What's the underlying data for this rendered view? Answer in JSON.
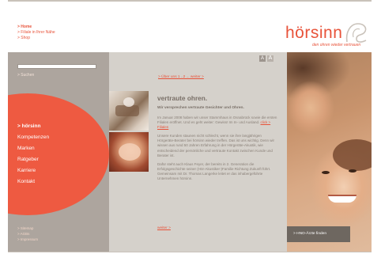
{
  "topnav": {
    "items": [
      "> Home",
      "> Filiale in Ihrer Nähe",
      "> Shop"
    ]
  },
  "logo": {
    "wordmark": "hörsinn",
    "tagline": "den ohren wieder vertrauen"
  },
  "sidebar": {
    "search_link": "> Suchen",
    "nav": [
      "> hörsinn",
      "Kompetenzen",
      "Marken",
      "Ratgeber",
      "Karriere",
      "Kontakt"
    ],
    "footer_links": [
      "> Sitemap",
      "> AGBs",
      "> Impressum"
    ]
  },
  "font_size": {
    "small": "A",
    "large": "A"
  },
  "main": {
    "pager": "> Über uns 1 ..2 ... weiter >",
    "title": "vertraute ohren.",
    "subtitle": "Wir versprechen vertraute Gesichter und Ohren.",
    "p1": "Im Januar 2008 haben wir unser Stammhaus in Osnabrück sowie die ersten Filialen eröffnet. Und es geht weiter: Gewiss! Im In- und Ausland.",
    "p1_link": "click > Filialen",
    "p2": "Unsere Kunden staunen nicht schlecht, wenn sie ihre langjährigen Hörgeräte-Berater bei hörsinn wieder treffen. Das ist uns wichtig. Denn wir wissen aus rund 50 Jahren Erfahrung in der Hörgeräte-Akustik, wie entscheidend der persönliche und vertraute Kontakt zwischen Kunde und Berater ist.",
    "p3": "Dafür steht auch Klaus Feyer, der bereits in 2. Generation die Erfolgsgeschichte seiner (Hör-Akustiker-)Familie Richtung Zukunft führt. Gemeinsam mit Dr. Thomas Langerke leitet er das inhabergeführte Unternehmen hörsinn.",
    "weiter": "weiter >"
  },
  "promo": {
    "finder_button": "> HNO-Ärzte finden"
  },
  "colors": {
    "accent": "#e8533a",
    "sidebar_bg": "#ada59e",
    "content_bg": "#d5d1cb"
  }
}
